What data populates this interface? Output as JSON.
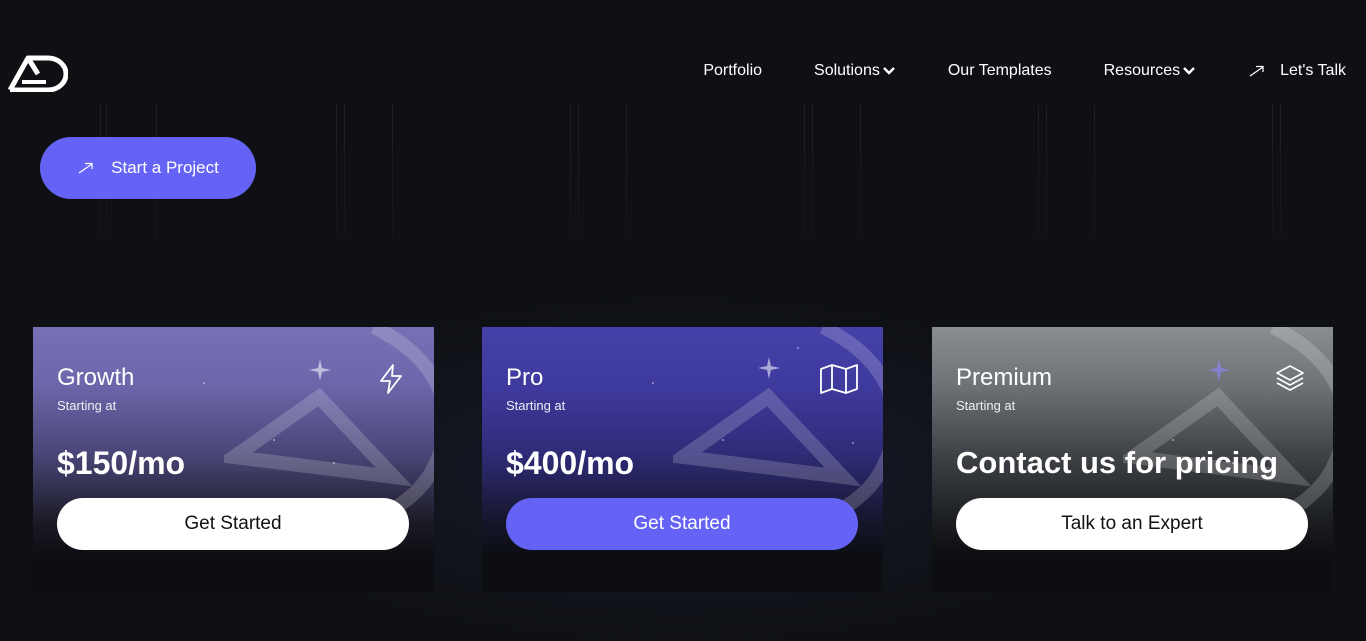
{
  "header": {
    "logo": "AD",
    "nav": [
      {
        "label": "Portfolio",
        "icon": null
      },
      {
        "label": "Solutions",
        "icon": "chevron-down-icon"
      },
      {
        "label": "Our Templates",
        "icon": null
      },
      {
        "label": "Resources",
        "icon": "chevron-down-icon"
      }
    ],
    "talk_label": "Let's Talk"
  },
  "hero": {
    "cta_label": "Start a Project"
  },
  "plans": [
    {
      "name": "Growth",
      "sub": "Starting at",
      "price": "$150/mo",
      "button": "Get Started",
      "icon": "lightning-icon"
    },
    {
      "name": "Pro",
      "sub": "Starting at",
      "price": "$400/mo",
      "button": "Get Started",
      "icon": "map-icon"
    },
    {
      "name": "Premium",
      "sub": "Starting at",
      "price": "Contact us for pricing",
      "button": "Talk to an Expert",
      "icon": "layers-icon"
    }
  ],
  "colors": {
    "background": "#0e1014",
    "accent": "#6563f6",
    "growth": "#7770b4",
    "pro": "#4641a8",
    "premium": "#8a8e92"
  }
}
